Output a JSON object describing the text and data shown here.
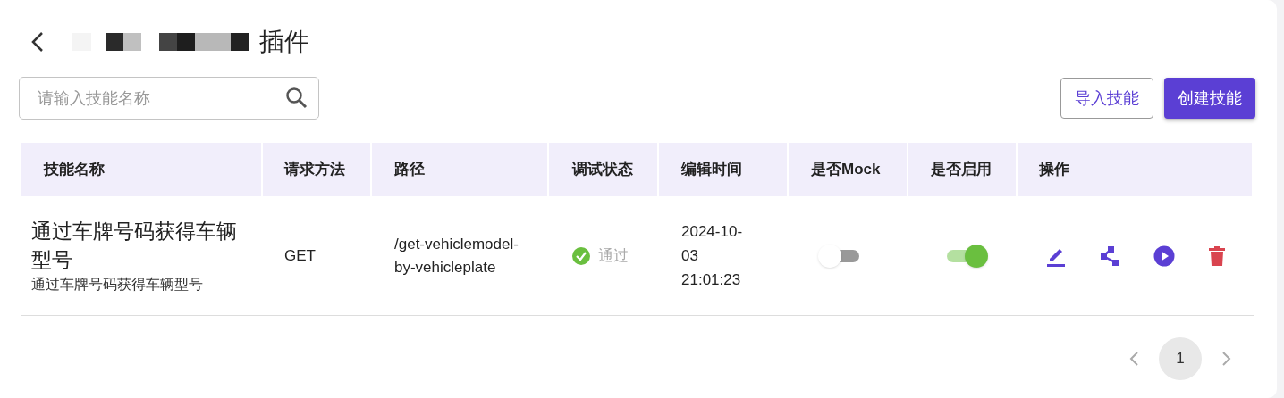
{
  "header": {
    "title": "插件"
  },
  "search": {
    "placeholder": "请输入技能名称"
  },
  "buttons": [
    {
      "label": "导入技能",
      "kind": "outline"
    },
    {
      "label": "创建技能",
      "kind": "primary"
    }
  ],
  "table": {
    "columns": [
      "技能名称",
      "请求方法",
      "路径",
      "调试状态",
      "编辑时间",
      "是否Mock",
      "是否启用",
      "操作"
    ],
    "rows": [
      {
        "name": "通过车牌号码获得车辆型号",
        "description": "通过车牌号码获得车辆型号",
        "method": "GET",
        "path": "/get-vehiclemodel-by-vehicleplate",
        "status": "通过",
        "passed": true,
        "edited": "2024-10-03 21:01:23",
        "mock": false,
        "enabled": true
      }
    ]
  },
  "pagination": {
    "pages": [
      {
        "label": "1",
        "selected": true
      }
    ]
  }
}
